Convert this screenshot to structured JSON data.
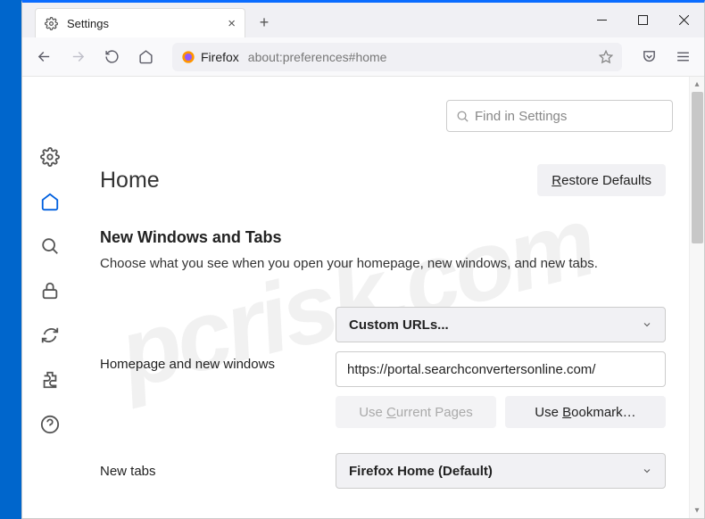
{
  "window": {
    "tab_title": "Settings",
    "url_identity": "Firefox",
    "url": "about:preferences#home"
  },
  "sidebar": {
    "items": [
      {
        "name": "general"
      },
      {
        "name": "home"
      },
      {
        "name": "search"
      },
      {
        "name": "privacy"
      },
      {
        "name": "sync"
      },
      {
        "name": "extensions"
      },
      {
        "name": "help"
      }
    ]
  },
  "page": {
    "search_placeholder": "Find in Settings",
    "title": "Home",
    "restore_button": "Restore Defaults",
    "section_title": "New Windows and Tabs",
    "section_desc": "Choose what you see when you open your homepage, new windows, and new tabs.",
    "row1": {
      "label": "Homepage and new windows",
      "select": "Custom URLs...",
      "url_value": "https://portal.searchconvertersonline.com/",
      "use_current": "Use Current Pages",
      "use_bookmark": "Use Bookmark…"
    },
    "row2": {
      "label": "New tabs",
      "select": "Firefox Home (Default)"
    }
  },
  "watermark": "pcrisk.com"
}
